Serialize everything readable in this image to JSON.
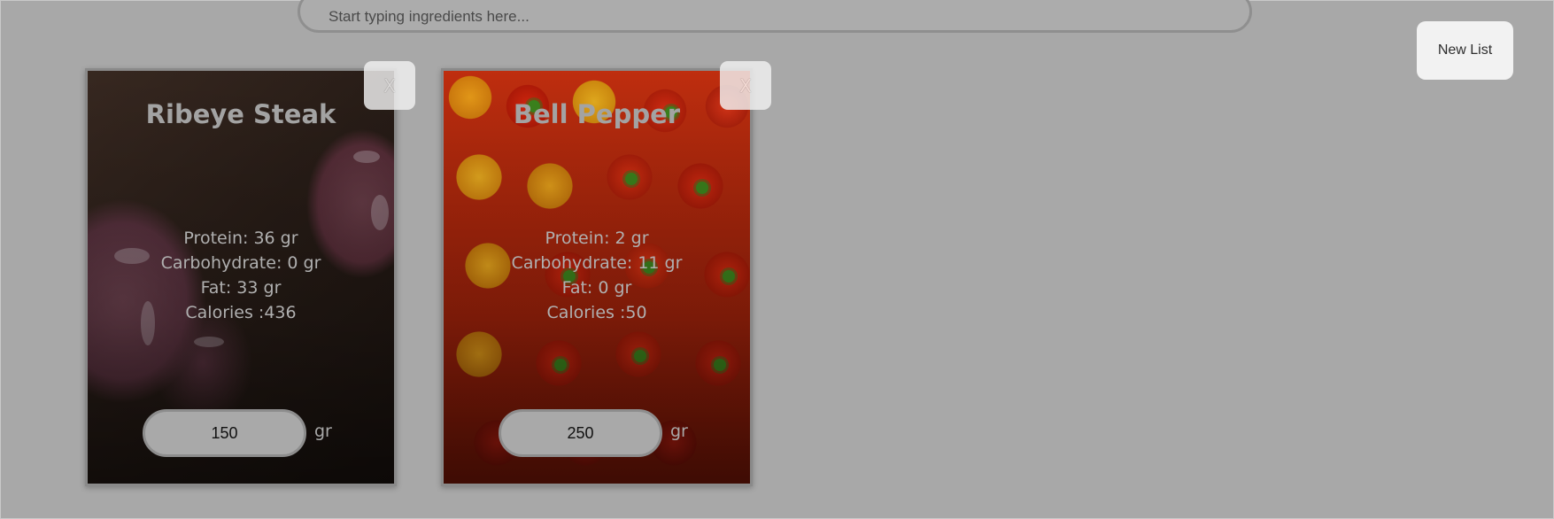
{
  "search": {
    "placeholder": "Start typing ingredients here..."
  },
  "toolbar": {
    "new_list_label": "New List"
  },
  "cards": [
    {
      "title": "Ribeye Steak",
      "remove_label": "X",
      "protein": "Protein: 36 gr",
      "carbohydrate": "Carbohydrate: 0 gr",
      "fat": "Fat: 33 gr",
      "calories": "Calories :436",
      "quantity": "150",
      "unit": "gr",
      "image": "ribeye-steak-photo"
    },
    {
      "title": "Bell Pepper",
      "remove_label": "X",
      "protein": "Protein: 2 gr",
      "carbohydrate": "Carbohydrate: 11 gr",
      "fat": "Fat: 0 gr",
      "calories": "Calories :50",
      "quantity": "250",
      "unit": "gr",
      "image": "bell-pepper-photo"
    }
  ],
  "colors": {
    "overlay_background": "#a8a8a8",
    "button_background": "#f2f2f2"
  }
}
